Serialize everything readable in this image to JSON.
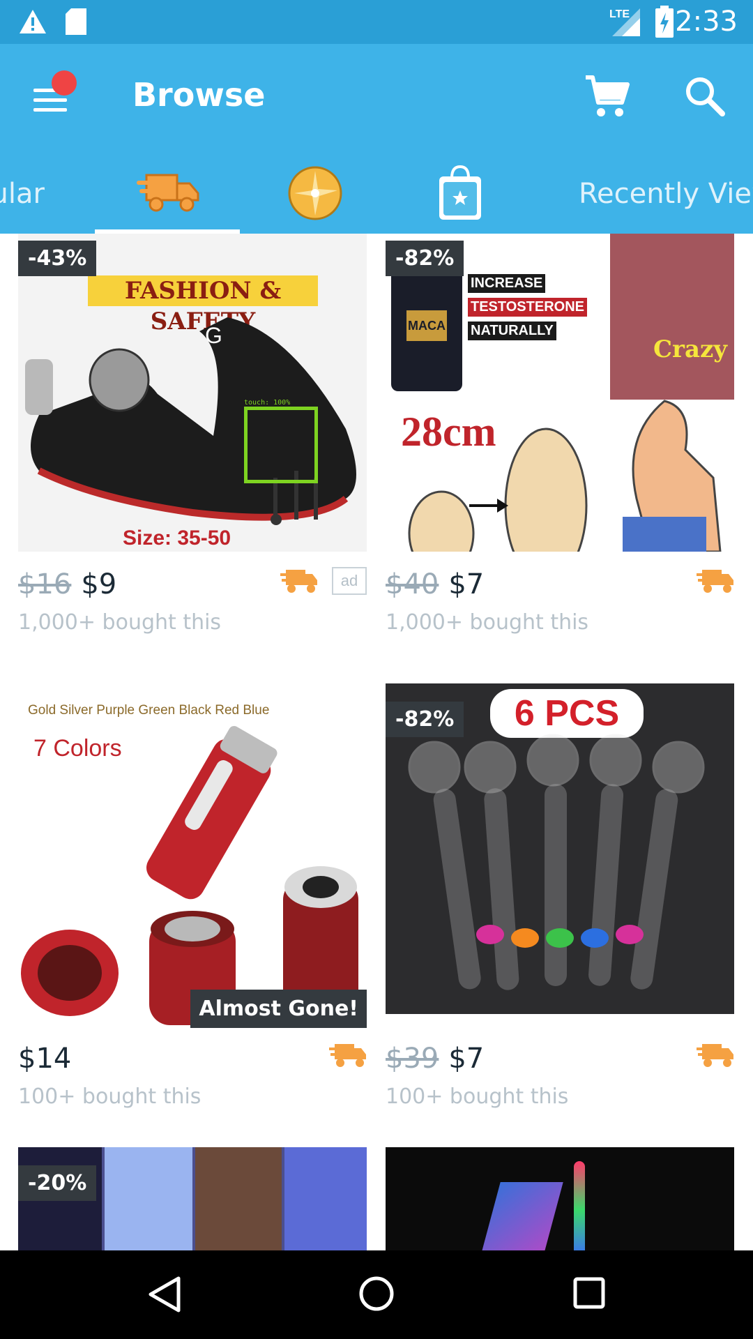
{
  "status_bar": {
    "network": "LTE",
    "time": "2:33"
  },
  "app_bar": {
    "title": "Browse"
  },
  "tabs": [
    {
      "label": "Popular"
    },
    {
      "icon": "fast-shipping-truck-icon"
    },
    {
      "icon": "blitz-buy-wheel-icon"
    },
    {
      "icon": "bag-star-icon"
    },
    {
      "label": "Recently Viewed"
    }
  ],
  "products": [
    {
      "discount": "-43%",
      "old_price": "$16",
      "price": "$9",
      "bought": "1,000+ bought this",
      "ad": "ad",
      "image": {
        "headline": "FASHION & SAFETY",
        "size": "Size: 35-50",
        "brand": "G"
      }
    },
    {
      "discount": "-82%",
      "old_price": "$40",
      "price": "$7",
      "bought": "1,000+ bought this",
      "image": {
        "line1": "INCREASE",
        "line2": "TESTOSTERONE",
        "line3": "NATURALLY",
        "length": "28cm",
        "tag": "Crazy",
        "bottle": "MACA"
      }
    },
    {
      "price": "$14",
      "bought": "100+ bought this",
      "almost_gone": "Almost Gone!",
      "image": {
        "colors_line": "Gold Silver Purple Green Black Red Blue",
        "colors_title": "7 Colors"
      }
    },
    {
      "discount": "-82%",
      "old_price": "$39",
      "price": "$7",
      "bought": "100+ bought this",
      "image": {
        "pcs": "6 PCS"
      }
    },
    {
      "discount": "-20%"
    },
    {}
  ],
  "touch_indicator": "touch: 100%",
  "colors": {
    "status_bar": "#2a9fd6",
    "app_bar": "#3eb3e8",
    "shipping_orange": "#f5a142",
    "badge_bg": "#343a3f"
  }
}
